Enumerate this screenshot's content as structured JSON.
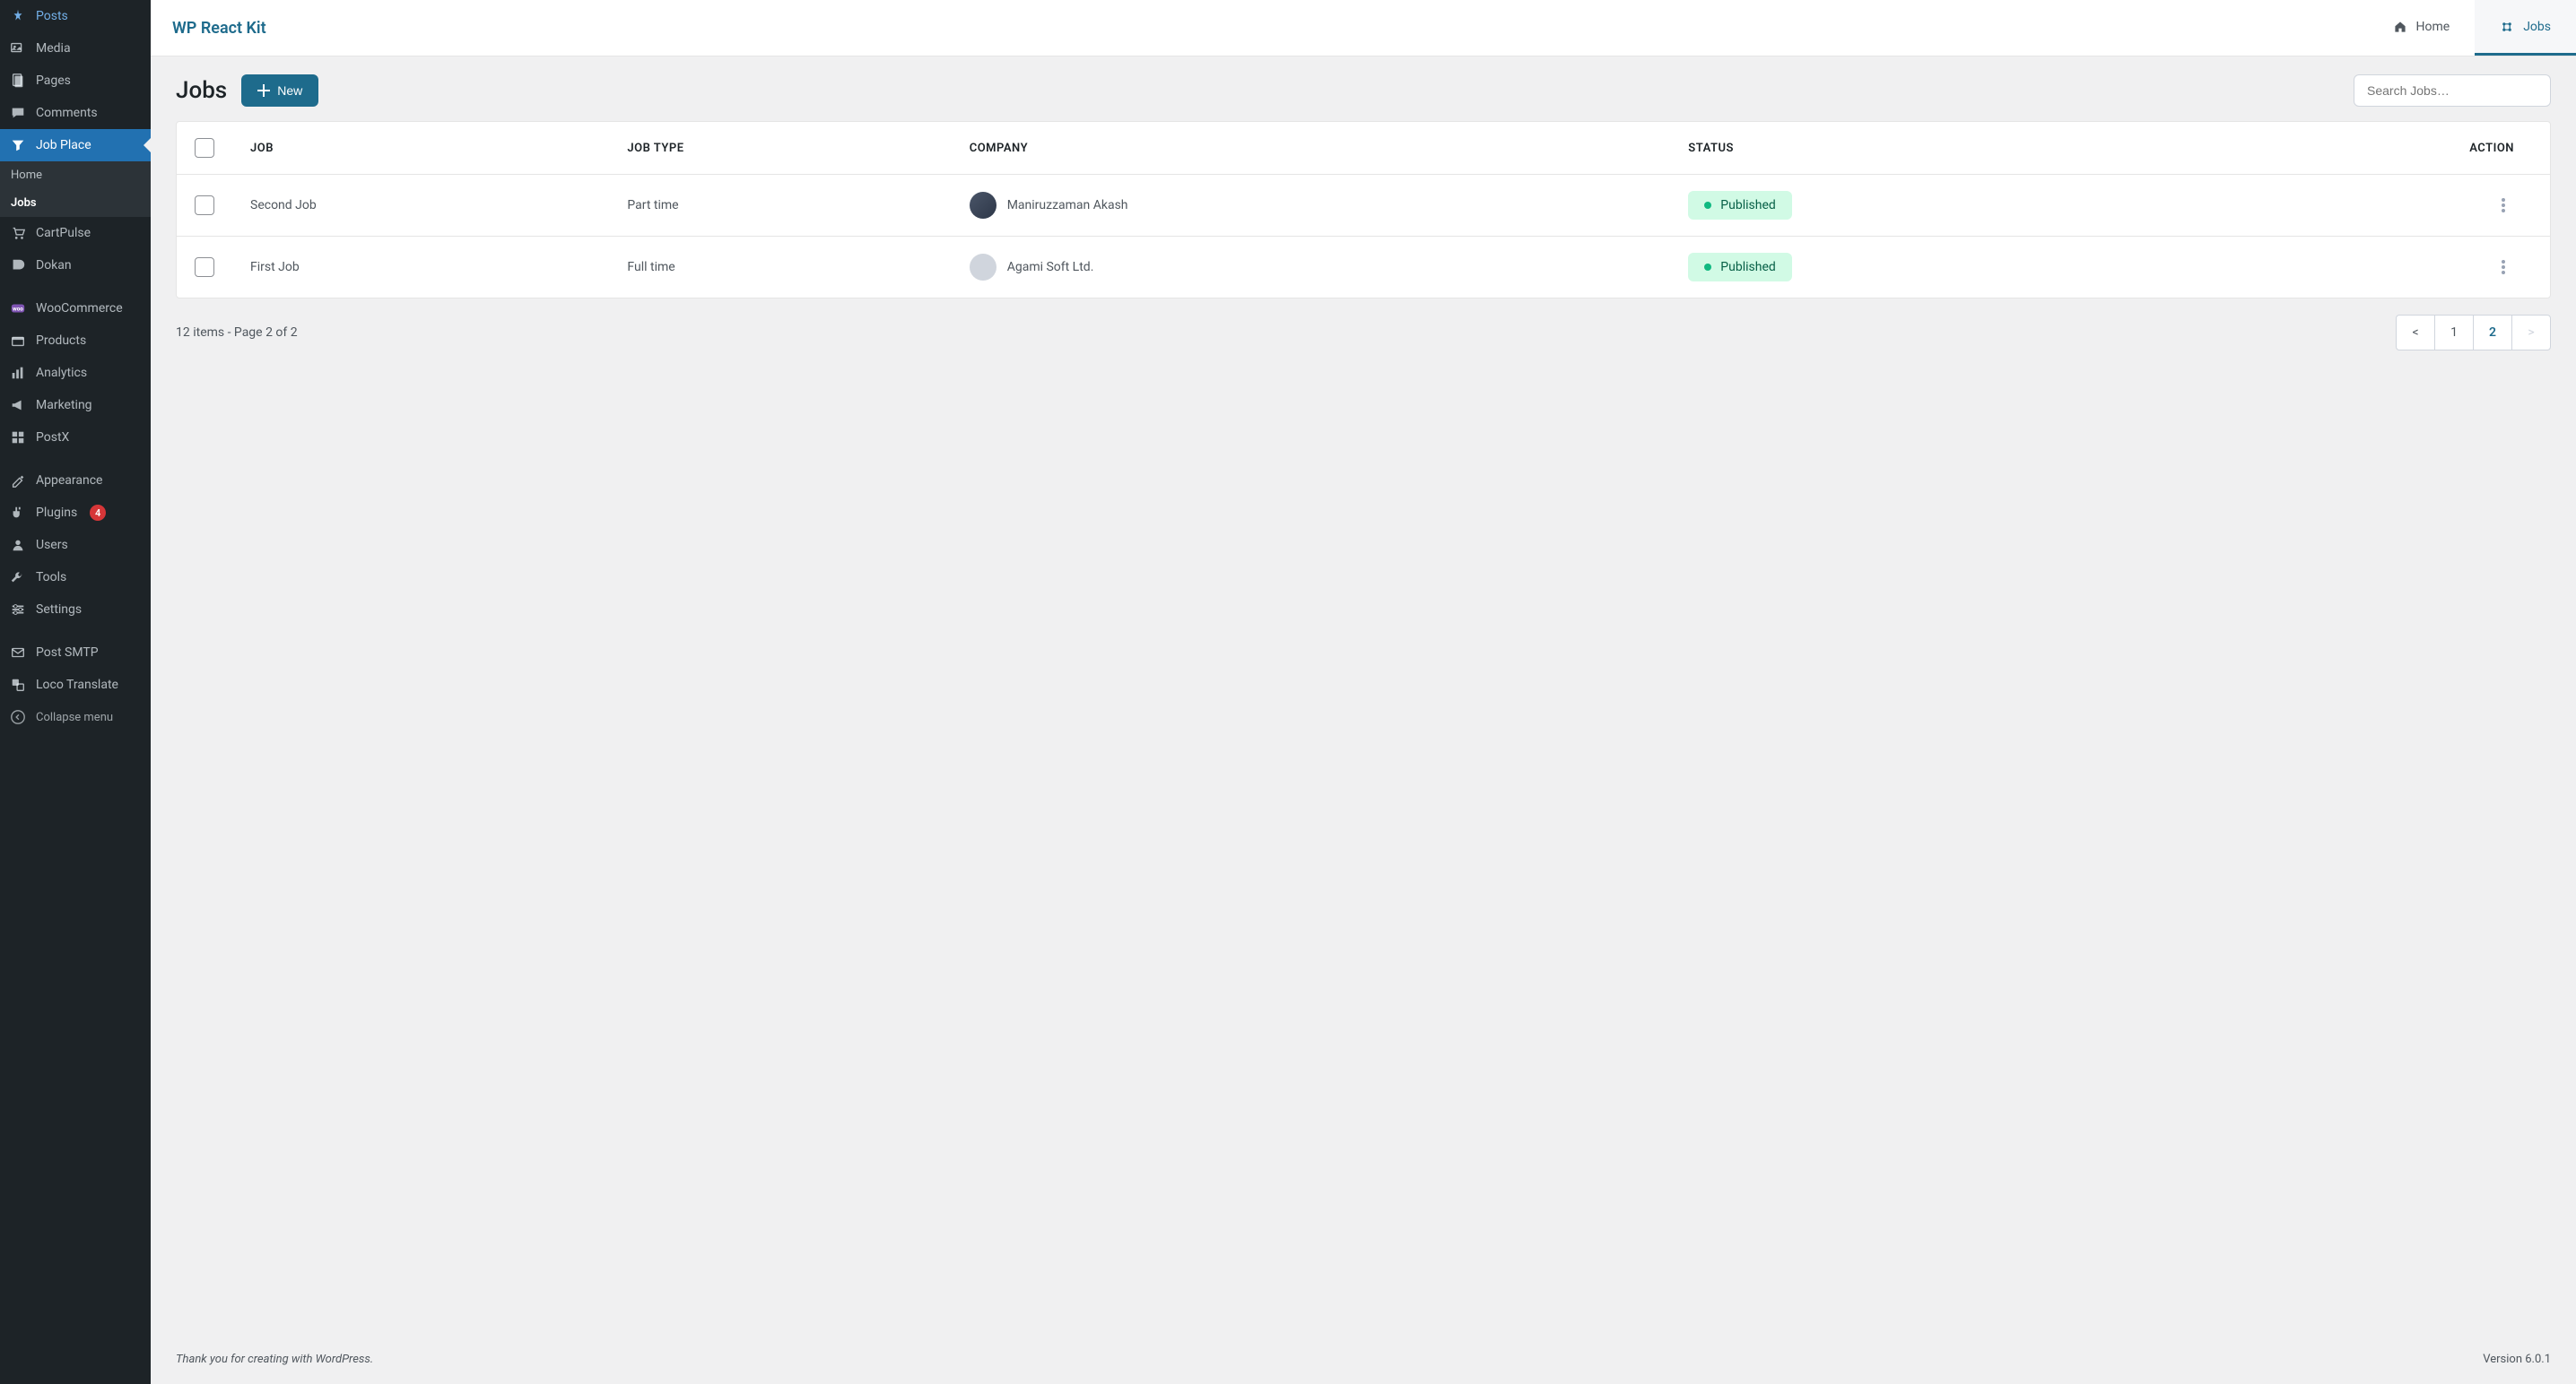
{
  "sidebar": {
    "items": [
      {
        "label": "Posts",
        "icon": "pin"
      },
      {
        "label": "Media",
        "icon": "media"
      },
      {
        "label": "Pages",
        "icon": "pages"
      },
      {
        "label": "Comments",
        "icon": "comments"
      },
      {
        "label": "Job Place",
        "icon": "filter",
        "active": true
      },
      {
        "label": "CartPulse",
        "icon": "cart"
      },
      {
        "label": "Dokan",
        "icon": "dokan"
      },
      {
        "label": "WooCommerce",
        "icon": "woo"
      },
      {
        "label": "Products",
        "icon": "products"
      },
      {
        "label": "Analytics",
        "icon": "analytics"
      },
      {
        "label": "Marketing",
        "icon": "marketing"
      },
      {
        "label": "PostX",
        "icon": "postx"
      },
      {
        "label": "Appearance",
        "icon": "appearance"
      },
      {
        "label": "Plugins",
        "icon": "plugins",
        "badge": "4"
      },
      {
        "label": "Users",
        "icon": "users"
      },
      {
        "label": "Tools",
        "icon": "tools"
      },
      {
        "label": "Settings",
        "icon": "settings"
      },
      {
        "label": "Post SMTP",
        "icon": "mail"
      },
      {
        "label": "Loco Translate",
        "icon": "translate"
      }
    ],
    "submenu": [
      {
        "label": "Home"
      },
      {
        "label": "Jobs",
        "active": true
      }
    ],
    "collapse_label": "Collapse menu"
  },
  "topbar": {
    "brand": "WP React Kit",
    "tabs": [
      {
        "label": "Home",
        "icon": "home"
      },
      {
        "label": "Jobs",
        "icon": "jobs",
        "active": true
      }
    ]
  },
  "page": {
    "title": "Jobs",
    "new_button": "New",
    "search_placeholder": "Search Jobs…"
  },
  "table": {
    "headers": {
      "job": "JOB",
      "job_type": "JOB TYPE",
      "company": "COMPANY",
      "status": "STATUS",
      "action": "ACTION"
    },
    "rows": [
      {
        "job": "Second Job",
        "job_type": "Part time",
        "company": "Maniruzzaman Akash",
        "status": "Published",
        "avatar": "blue"
      },
      {
        "job": "First Job",
        "job_type": "Full time",
        "company": "Agami Soft Ltd.",
        "status": "Published",
        "avatar": "gray"
      }
    ]
  },
  "pagination": {
    "info": "12 items - Page 2 of 2",
    "prev": "<",
    "next": ">",
    "pages": [
      "1",
      "2"
    ],
    "active_page": "2"
  },
  "footer": {
    "thanks": "Thank you for creating with WordPress.",
    "version": "Version 6.0.1"
  }
}
